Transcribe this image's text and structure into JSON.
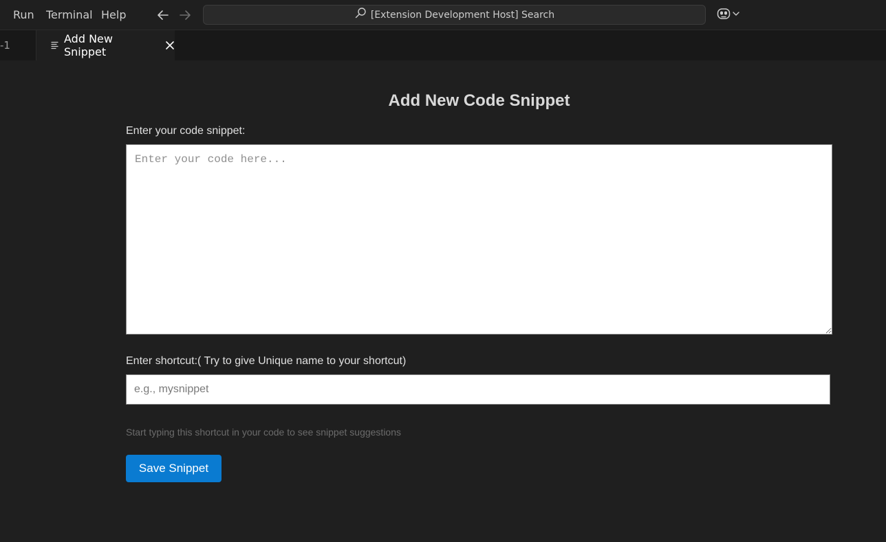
{
  "menu": {
    "items": [
      "Run",
      "Terminal",
      "Help"
    ]
  },
  "search": {
    "text": "[Extension Development Host] Search"
  },
  "tabs": {
    "previous_label": "-1",
    "active_label": "Add New Snippet"
  },
  "form": {
    "title": "Add New Code Snippet",
    "code_label": "Enter your code snippet:",
    "code_placeholder": "Enter your code here...",
    "shortcut_label": "Enter shortcut:( Try to give Unique name to your shortcut)",
    "shortcut_placeholder": "e.g., mysnippet",
    "hint": "Start typing this shortcut in your code to see snippet suggestions",
    "save_label": "Save Snippet"
  },
  "colors": {
    "background": "#1f1f1f",
    "titlebar": "#1f1f1f",
    "tabbar": "#181818",
    "accent_button": "#0a7bd1"
  },
  "icons": {
    "back": "arrow-left-icon",
    "forward": "arrow-right-icon",
    "search": "search-icon",
    "copilot": "copilot-icon",
    "tab_file": "file-lines-icon",
    "tab_close": "close-icon"
  }
}
